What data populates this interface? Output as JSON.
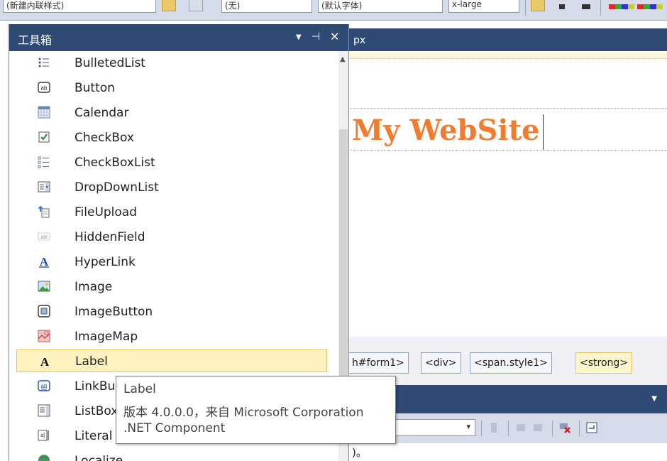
{
  "toolbar": {
    "combo1": "(新建内联样式)",
    "combo2": "(无)",
    "combo3": "(默认字体)",
    "combo4": "x-large"
  },
  "editor": {
    "tab_label": "px",
    "website_title": "My WebSite",
    "title_color": "#f07c30"
  },
  "tag_bar": {
    "tags": [
      {
        "label": "h#form1>"
      },
      {
        "label": "<div>"
      },
      {
        "label": "<span.style1>"
      },
      {
        "label": "<strong>",
        "selected": true
      }
    ]
  },
  "output": {
    "text": ")。"
  },
  "toolbox": {
    "title": "工具箱",
    "items": [
      {
        "label": "BulletedList",
        "icon": "bulleted-list-icon"
      },
      {
        "label": "Button",
        "icon": "button-icon"
      },
      {
        "label": "Calendar",
        "icon": "calendar-icon"
      },
      {
        "label": "CheckBox",
        "icon": "checkbox-icon"
      },
      {
        "label": "CheckBoxList",
        "icon": "checkbox-list-icon"
      },
      {
        "label": "DropDownList",
        "icon": "dropdown-list-icon"
      },
      {
        "label": "FileUpload",
        "icon": "file-upload-icon"
      },
      {
        "label": "HiddenField",
        "icon": "hidden-field-icon"
      },
      {
        "label": "HyperLink",
        "icon": "hyperlink-icon"
      },
      {
        "label": "Image",
        "icon": "image-icon"
      },
      {
        "label": "ImageButton",
        "icon": "image-button-icon"
      },
      {
        "label": "ImageMap",
        "icon": "image-map-icon"
      },
      {
        "label": "Label",
        "icon": "label-icon",
        "selected": true
      },
      {
        "label": "LinkBu",
        "icon": "link-button-icon"
      },
      {
        "label": "ListBox",
        "icon": "list-box-icon"
      },
      {
        "label": "Literal",
        "icon": "literal-icon"
      },
      {
        "label": "Localize",
        "icon": "localize-icon"
      }
    ]
  },
  "tooltip": {
    "name": "Label",
    "version": "版本 4.0.0.0，来自 Microsoft Corporation",
    "type": ".NET Component"
  },
  "colors": {
    "header_blue": "#2f4a74",
    "selection_fill": "#fdf2bf",
    "selection_border": "#e5c365"
  }
}
